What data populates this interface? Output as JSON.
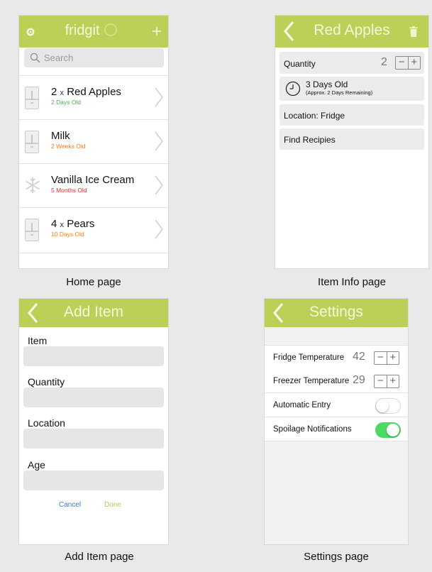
{
  "home": {
    "title": "fridgit",
    "search_placeholder": "Search",
    "caption": "Home page",
    "items": [
      {
        "qty": "2",
        "x": "x",
        "name": "Red Apples",
        "age": "2 Days Old",
        "age_color": "#4cb04c",
        "icon": "fridge-icon"
      },
      {
        "qty": "",
        "x": "",
        "name": "Milk",
        "age": "2 Weeks Old",
        "age_color": "#ef7d22",
        "icon": "fridge-icon"
      },
      {
        "qty": "",
        "x": "",
        "name": "Vanilla Ice Cream",
        "age": "5 Months Old",
        "age_color": "#e0302a",
        "icon": "snowflake-icon"
      },
      {
        "qty": "4",
        "x": "x",
        "name": "Pears",
        "age": "10 Days Old",
        "age_color": "#ef7d22",
        "icon": "fridge-icon"
      }
    ]
  },
  "item_info": {
    "title": "Red Apples",
    "caption": "Item Info page",
    "quantity_label": "Quantity",
    "quantity_value": "2",
    "age_main": "3 Days Old",
    "age_sub": "(Approx. 2 Days Remaining)",
    "location": "Location: Fridge",
    "find_recipes": "Find Recipies"
  },
  "add_item": {
    "title": "Add Item",
    "caption": "Add Item page",
    "fields": [
      "Item",
      "Quantity",
      "Location",
      "Age"
    ],
    "cancel": "Cancel",
    "done": "Done"
  },
  "settings": {
    "title": "Settings",
    "caption": "Settings page",
    "fridge_label": "Fridge Temperature",
    "fridge_value": "42",
    "freezer_label": "Freezer Temperature",
    "freezer_value": "29",
    "auto_label": "Automatic Entry",
    "auto_on": false,
    "spoilage_label": "Spoilage Notifications",
    "spoilage_on": true
  },
  "colors": {
    "accent": "#bcd057",
    "link_blue": "#3a7bd5",
    "done_green": "#b6c95a",
    "toggle_on": "#4cd964"
  }
}
